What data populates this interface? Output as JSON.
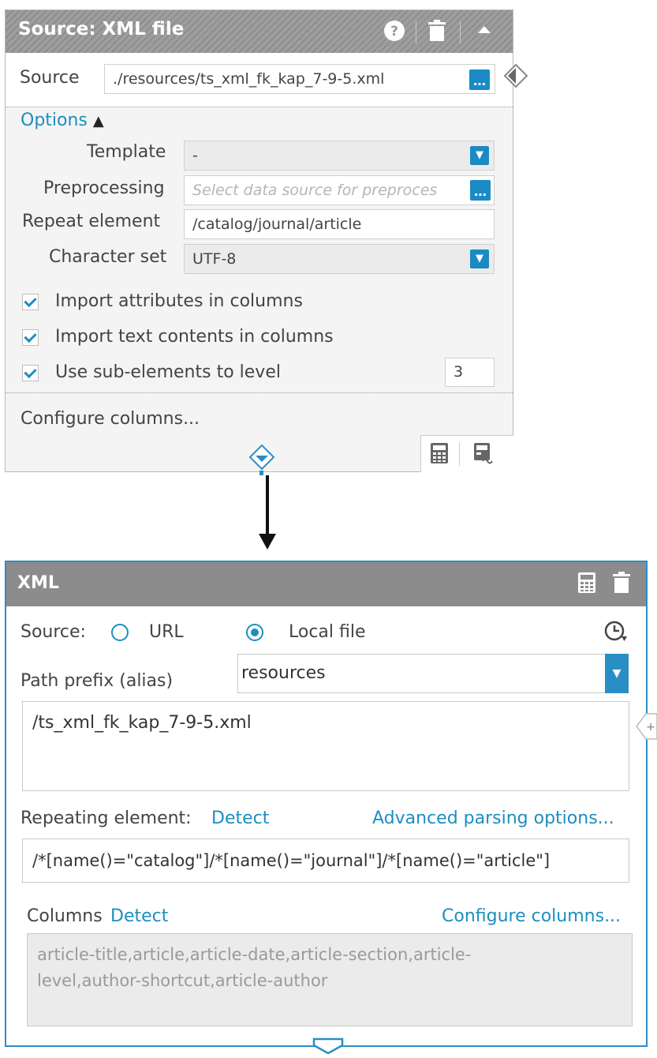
{
  "source_panel": {
    "title": "Source: XML file",
    "source_label": "Source",
    "source_value": "./resources/ts_xml_fk_kap_7-9-5.xml",
    "options_label": "Options",
    "options_arrow": "▲",
    "template_label": "Template",
    "template_value": "-",
    "preprocessing_label": "Preprocessing",
    "preprocessing_placeholder": "Select data source for preproces",
    "repeat_label": "Repeat element",
    "repeat_value": "/catalog/journal/article",
    "charset_label": "Character set",
    "charset_value": "UTF-8",
    "checkbox_attributes": "Import attributes in columns",
    "checkbox_text": "Import text contents in columns",
    "checkbox_subelements": "Use sub-elements to level",
    "level_value": "3",
    "configure_columns": "Configure columns..."
  },
  "xml_panel": {
    "title": "XML",
    "source_label": "Source:",
    "url_label": "URL",
    "local_label": "Local file",
    "selected_source": "Local file",
    "path_prefix_label": "Path prefix (alias)",
    "path_prefix_value": "resources",
    "file_path": "/ts_xml_fk_kap_7-9-5.xml",
    "repeating_label": "Repeating element:",
    "detect_label": "Detect",
    "advanced_label": "Advanced parsing options...",
    "repeating_value": "/*[name()=\"catalog\"]/*[name()=\"journal\"]/*[name()=\"article\"]",
    "columns_label": "Columns",
    "columns_detect": "Detect",
    "configure_columns": "Configure columns...",
    "columns_value": "article-title,article,article-date,article-section,article-level,author-shortcut,article-author"
  },
  "colors": {
    "accent": "#1d8ec0",
    "header_gray": "#8c8c8c",
    "panel_border": "#2a8ec6"
  },
  "icons": [
    "help-icon",
    "trash-icon",
    "collapse-icon",
    "browse-icon",
    "output-connector-icon",
    "calculator-icon",
    "schema-icon",
    "history-icon",
    "add-connector-icon",
    "connector-arrow-icon"
  ]
}
